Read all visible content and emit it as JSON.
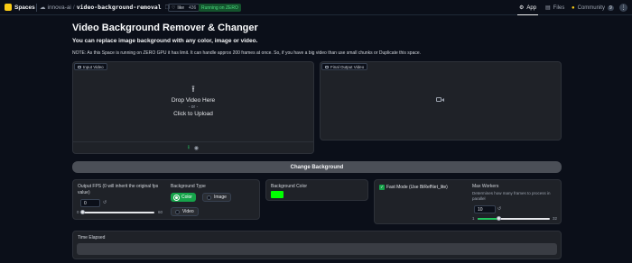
{
  "topbar": {
    "brand": "Spaces",
    "owner": "innova-ai",
    "slash": "/",
    "repo_name": "video-background-removal",
    "like_label": "like",
    "like_count": "436",
    "status": "Running on ZERO",
    "tabs": [
      {
        "label": "App"
      },
      {
        "label": "Files"
      },
      {
        "label": "Community",
        "badge": "9"
      }
    ],
    "more": "⋮"
  },
  "header": {
    "title": "Video Background Remover & Changer",
    "subtitle": "You can replace image background with any color, image or video.",
    "note": "NOTE: As this Space is running on ZERO GPU it has limit. It can handle approx 200 frames at once. So, if you have a big video than use small chunks or Duplicate this space."
  },
  "input_video": {
    "tag": "Input Video",
    "drop_line1": "Drop Video Here",
    "drop_line2": "- or -",
    "drop_line3": "Click to Upload"
  },
  "output_video": {
    "tag": "Final Output Video"
  },
  "change_button": "Change Background",
  "fps": {
    "label": "Output FPS (0 will inherit the original fps value)",
    "value": "0",
    "min": "0",
    "max": "60",
    "level_fraction": 0
  },
  "bg_type": {
    "label": "Background Type",
    "options": [
      "Color",
      "Image",
      "Video"
    ],
    "selected": "Color"
  },
  "bg_color": {
    "label": "Background Color",
    "color": "#00ff00"
  },
  "fast_mode": {
    "label": "Fast Mode (Use BiRefNet_lite)",
    "checked": true
  },
  "max_workers": {
    "label": "Max Workers",
    "description": "Determines how many frames to process in parallel",
    "value": "10",
    "min": "1",
    "max": "32",
    "level_fraction": 0.29
  },
  "time_elapsed": {
    "label": "Time Elapsed",
    "value": ""
  },
  "colors": {
    "accent": "#16a34a",
    "background": "#0b0f19",
    "panel": "#1f2228"
  }
}
